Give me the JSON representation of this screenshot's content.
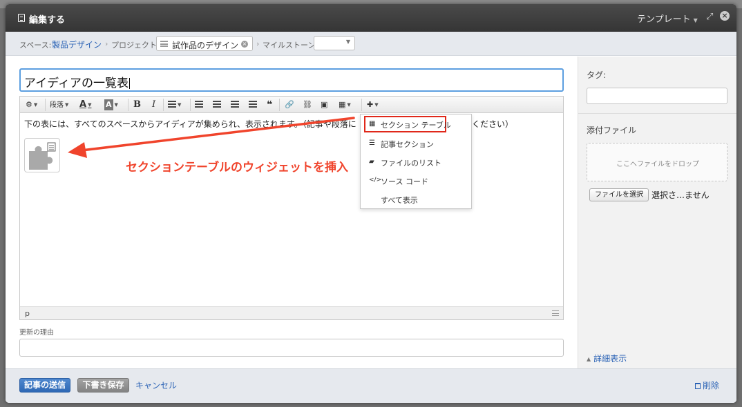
{
  "window": {
    "title": "編集する",
    "template_menu": "テンプレート"
  },
  "breadcrumb": {
    "space_label": "スペース:",
    "space_value": "製品デザイン",
    "project_label": "プロジェクト",
    "project_value": "試作品のデザイン",
    "milestone_label": "マイルストーン",
    "milestone_value": ""
  },
  "editor": {
    "title_value": "アイディアの一覧表",
    "toolbar": {
      "paragraph": "段落"
    },
    "body_text": "下の表には、すべてのスペースからアイディアが集められ、表示されます。（記事や段落に",
    "body_text_tail": "ください）",
    "status_element": "p"
  },
  "insert_menu": {
    "items": [
      {
        "label": "セクション テーブル",
        "icon": "grid-icon",
        "highlighted": true
      },
      {
        "label": "記事セクション",
        "icon": "list-icon"
      },
      {
        "label": "ファイルのリスト",
        "icon": "folder-icon"
      },
      {
        "label": "ソース コード",
        "icon": "code-icon"
      },
      {
        "label": "すべて表示",
        "icon": ""
      }
    ]
  },
  "annotation": {
    "text": "セクションテーブルのウィジェットを挿入",
    "color": "#f0442c"
  },
  "reason": {
    "label": "更新の理由",
    "value": ""
  },
  "sidebar": {
    "tag_label": "タグ:",
    "tag_value": "",
    "attachments_label": "添付ファイル",
    "dropzone_text": "ここへファイルをドロップ",
    "file_button": "ファイルを選択",
    "file_status": "選択さ…ません",
    "details_link": "詳細表示"
  },
  "footer": {
    "submit": "記事の送信",
    "draft": "下書き保存",
    "cancel": "キャンセル",
    "delete": "削除"
  },
  "colors": {
    "accent": "#2a62b5",
    "highlight": "#e0281a"
  }
}
